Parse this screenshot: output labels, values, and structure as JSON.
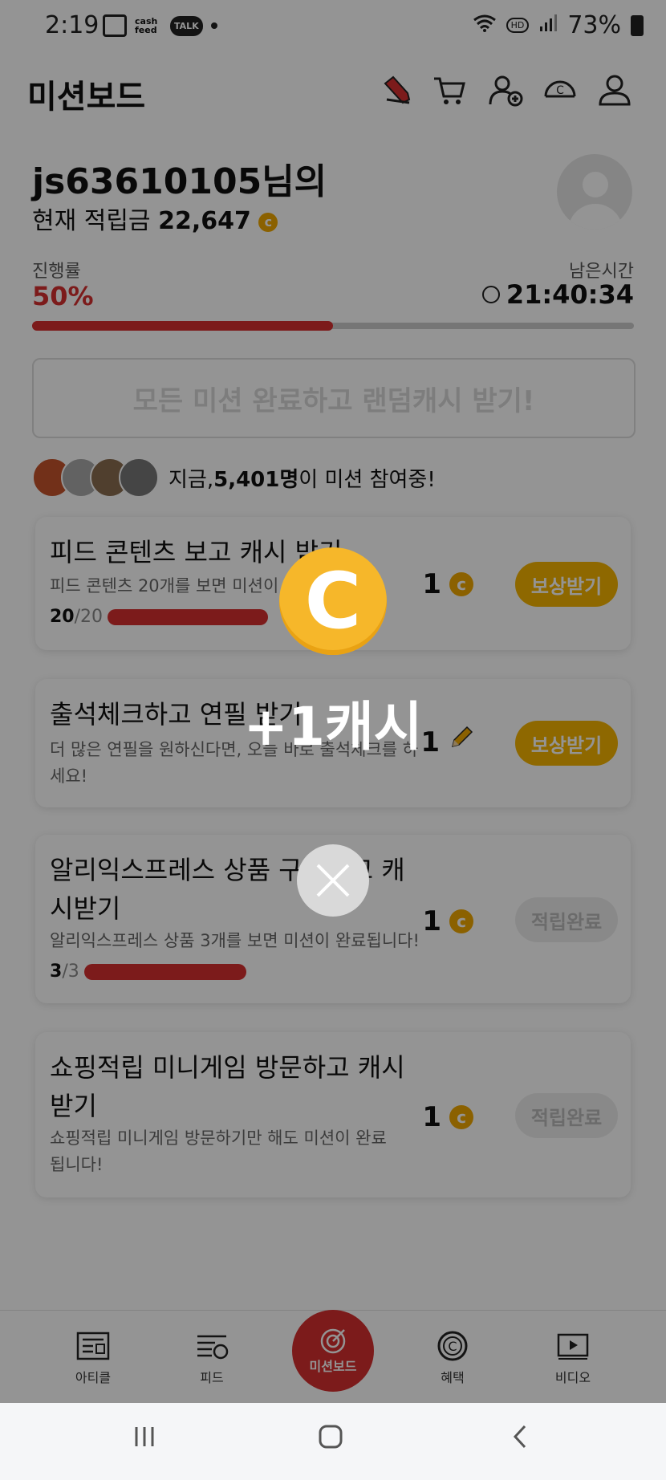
{
  "status_bar": {
    "time": "2:19",
    "apps": [
      "cash feed",
      "TALK"
    ],
    "hd": "HD",
    "battery": "73%"
  },
  "header": {
    "title": "미션보드"
  },
  "user": {
    "name": "js63610105님의",
    "balance_label": "현재 적립금",
    "balance": "22,647"
  },
  "progress": {
    "label": "진행률",
    "value": "50%",
    "fraction": 0.5
  },
  "timer": {
    "label": "남은시간",
    "value": "21:40:34"
  },
  "banner": {
    "text": "모든 미션 완료하고 랜덤캐시 받기!"
  },
  "participants": {
    "prefix": "지금, ",
    "count": "5,401명",
    "suffix": "이 미션 참여중!"
  },
  "missions": [
    {
      "title": "피드 콘텐츠 보고 캐시 받기",
      "desc": "피드 콘텐츠 20개를 보면 미션이",
      "progress_done": "20",
      "progress_total": "/20",
      "reward": "1",
      "reward_icon": "coin-icon",
      "button": "보상받기",
      "state": "active"
    },
    {
      "title": "출석체크하고 연필 받기",
      "desc": "더 많은 연필을 원하신다면, 오늘 바로 출석체크를 하세요!",
      "reward": "1",
      "reward_icon": "pencil-icon",
      "button": "보상받기",
      "state": "active"
    },
    {
      "title": "알리익스프레스 상품 구경하고 캐시받기",
      "desc": "알리익스프레스 상품 3개를 보면 미션이 완료됩니다!",
      "progress_done": "3",
      "progress_total": "/3",
      "reward": "1",
      "reward_icon": "coin-icon",
      "button": "적립완료",
      "state": "done"
    },
    {
      "title": "쇼핑적립 미니게임 방문하고 캐시 받기",
      "desc": "쇼핑적립 미니게임 방문하기만 해도 미션이 완료됩니다!",
      "reward": "1",
      "reward_icon": "coin-icon",
      "button": "적립완료",
      "state": "done"
    }
  ],
  "bottom_nav": {
    "article": "아티클",
    "feed": "피드",
    "mission": "미션보드",
    "benefit": "혜택",
    "video": "비디오"
  },
  "popup": {
    "reward_text": "+1캐시",
    "coin_letter": "C"
  },
  "colors": {
    "accent": "#d63030",
    "coin": "#f4b400",
    "done": "#ededed"
  }
}
